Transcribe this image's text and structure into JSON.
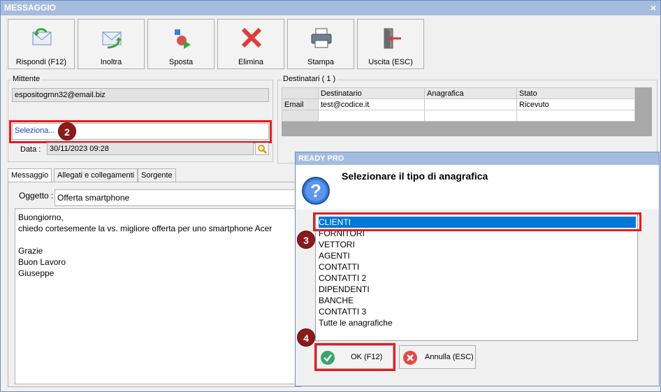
{
  "window": {
    "title": "MESSAGGIO",
    "close": "×"
  },
  "toolbar": [
    {
      "label": "Rispondi (F12)",
      "icon": "reply-mail-icon"
    },
    {
      "label": "Inoltra",
      "icon": "forward-mail-icon"
    },
    {
      "label": "Sposta",
      "icon": "move-icon"
    },
    {
      "label": "Elimina",
      "icon": "delete-icon"
    },
    {
      "label": "Stampa",
      "icon": "printer-icon"
    },
    {
      "label": "Uscita (ESC)",
      "icon": "exit-door-icon"
    }
  ],
  "mittente": {
    "label": "Mittente",
    "email": "espositogrnn32@email.biz",
    "select": "Seleziona...",
    "date_label": "Data :",
    "date": "30/11/2023 09:28"
  },
  "destinatari": {
    "label": "Destinatari ( 1 )",
    "columns": [
      "Destinatario",
      "Anagrafica",
      "Stato"
    ],
    "rows": [
      {
        "type": "Email",
        "destinatario": "test@codice.it",
        "anagrafica": "",
        "stato": "Ricevuto"
      }
    ]
  },
  "tabs": [
    "Messaggio",
    "Allegati e collegamenti",
    "Sorgente"
  ],
  "message": {
    "subject_label": "Oggetto :",
    "subject": "Offerta smartphone",
    "lines": [
      "Buongiorno,",
      "chiedo cortesemente la vs. migliore offerta per uno smartphone Acer",
      "",
      "Grazie",
      "Buon Lavoro",
      "Giuseppe"
    ]
  },
  "dialog": {
    "title": "READY PRO",
    "heading": "Selezionare il tipo di anagrafica",
    "items": [
      "CLIENTI",
      "FORNITORI",
      "VETTORI",
      "AGENTI",
      "CONTATTI",
      "CONTATTI 2",
      "DIPENDENTI",
      "BANCHE",
      "CONTATTI 3",
      "Tutte le anagrafiche"
    ],
    "selected": "CLIENTI",
    "ok": "OK (F12)",
    "cancel": "Annulla (ESC)"
  },
  "badges": [
    "2",
    "3",
    "4"
  ],
  "colors": {
    "title_bar": "#a6bcdf",
    "selection": "#0078d7",
    "highlight_red": "#e51b24",
    "badge": "#8b1a1a"
  }
}
